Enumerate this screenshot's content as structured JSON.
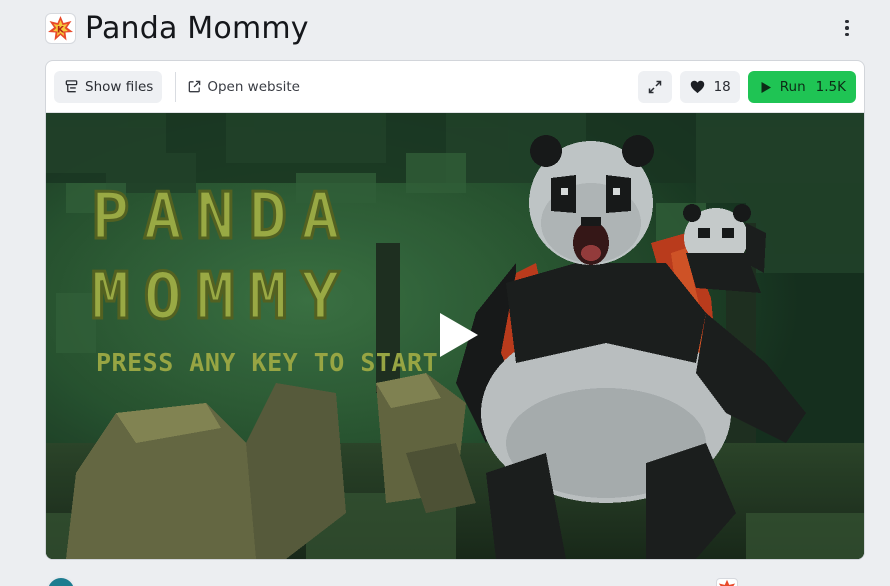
{
  "header": {
    "title": "Panda Mommy",
    "logo_icon": "replit-style-badge-icon",
    "menu_icon": "kebab-menu-icon"
  },
  "toolbar": {
    "show_files_label": "Show files",
    "open_website_label": "Open website",
    "likes_count": "18",
    "run_label": "Run",
    "run_count": "1.5K"
  },
  "game": {
    "title_line1": "PANDA",
    "title_line2": "MOMMY",
    "prompt": "PRESS ANY KEY TO START"
  },
  "colors": {
    "run_green": "#1fc454",
    "pixel_text": "#a6b84a",
    "panda_black": "#1a1c1c",
    "panda_white": "#c9cfd0",
    "backpack_red": "#c9401f"
  }
}
